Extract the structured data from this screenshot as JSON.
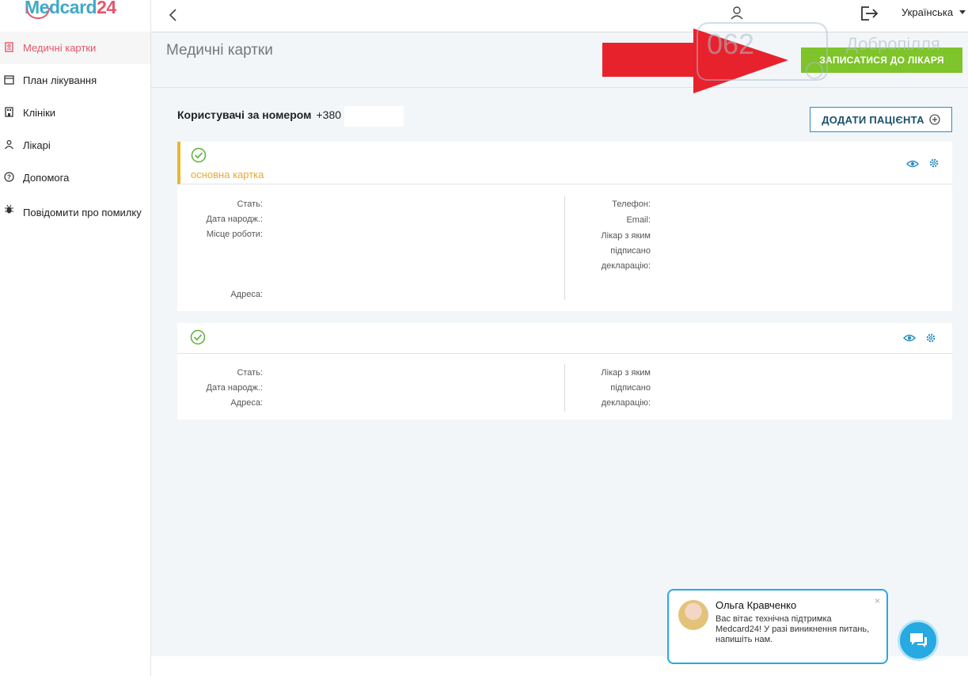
{
  "brand": {
    "logo_prefix": "M",
    "logo_mid": "edcard",
    "logo_suffix": "24"
  },
  "sidebar": {
    "items": [
      {
        "label": "Медичні картки",
        "icon": "medical-card-icon"
      },
      {
        "label": "План лікування",
        "icon": "calendar-icon"
      },
      {
        "label": "Клініки",
        "icon": "building-icon"
      },
      {
        "label": "Лікарі",
        "icon": "doctor-icon"
      },
      {
        "label": "Допомога",
        "icon": "help-icon"
      },
      {
        "label": "Повідомити про помилку",
        "icon": "bug-icon"
      }
    ]
  },
  "topbar": {
    "language": "Українська"
  },
  "page": {
    "title": "Медичні картки",
    "book_button": "ЗАПИСАТИСЯ ДО ЛІКАРЯ",
    "watermark_left": "062",
    "watermark_right": "Добропілля",
    "users_label": "Користувачі за номером",
    "users_phone": "+380",
    "add_patient": "ДОДАТИ ПАЦІЄНТА"
  },
  "cards": [
    {
      "badge": "основна картка",
      "left_fields": [
        "Стать:",
        "Дата народж.:",
        "Місце роботи:",
        "Адреса:"
      ],
      "right_fields": [
        "Телефон:",
        "Email:",
        "Лікар з яким",
        "підписано",
        "декларацію:"
      ]
    },
    {
      "left_fields": [
        "Стать:",
        "Дата народж.:",
        "Адреса:"
      ],
      "right_fields": [
        "Лікар з яким",
        "підписано",
        "декларацію:"
      ]
    }
  ],
  "chat": {
    "agent_name": "Ольга Кравченко",
    "message": "Вас вітає технічна підтримка Medcard24! У разі виникнення питань, напишіть нам.",
    "close": "×"
  },
  "colors": {
    "accent_red": "#e3566c",
    "accent_blue": "#2a8fc1",
    "green": "#7ec42a",
    "yellow": "#e8b630",
    "chat_blue": "#27a9e1"
  }
}
